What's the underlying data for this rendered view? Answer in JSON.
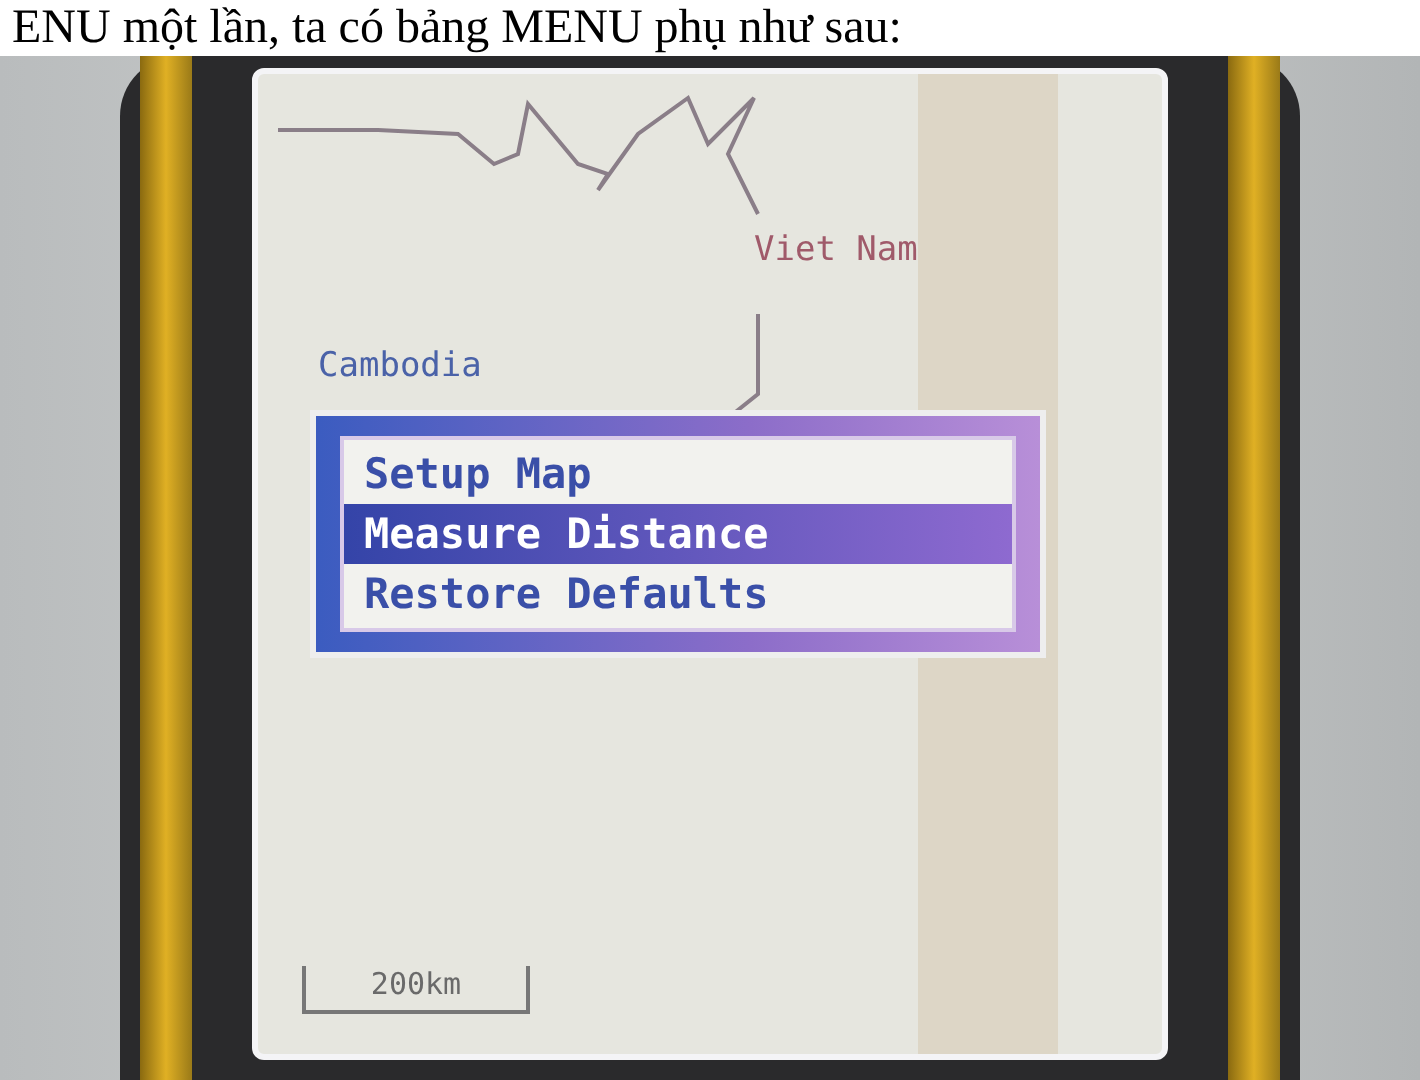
{
  "caption": "ENU một lần, ta có bảng MENU phụ như sau:",
  "map": {
    "labels": [
      "Viet Nam",
      "Cambodia"
    ],
    "scale": "200km"
  },
  "menu": {
    "items": [
      {
        "label": "Setup Map",
        "selected": false
      },
      {
        "label": "Measure Distance",
        "selected": true
      },
      {
        "label": "Restore Defaults",
        "selected": false
      }
    ]
  }
}
